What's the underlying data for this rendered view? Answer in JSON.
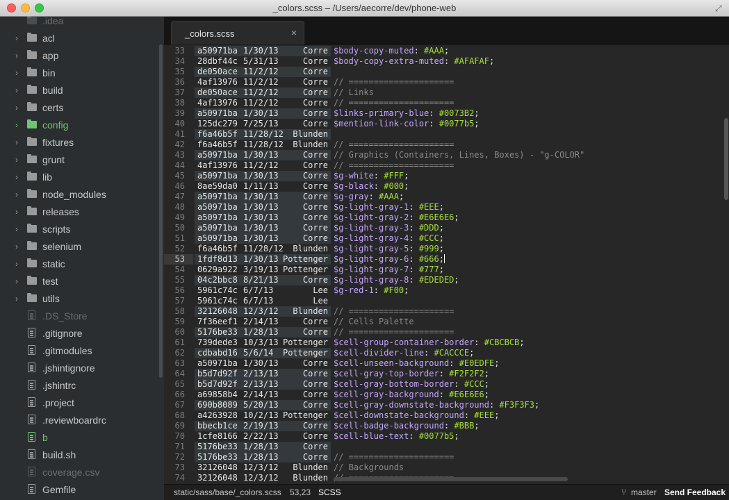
{
  "window": {
    "title": "_colors.scss – /Users/aecorre/dev/phone-web"
  },
  "sidebar": {
    "items": [
      {
        "label": ".idea",
        "kind": "folder",
        "state": "dim"
      },
      {
        "label": "acl",
        "kind": "folder",
        "state": "normal"
      },
      {
        "label": "app",
        "kind": "folder",
        "state": "normal"
      },
      {
        "label": "bin",
        "kind": "folder",
        "state": "normal"
      },
      {
        "label": "build",
        "kind": "folder",
        "state": "normal"
      },
      {
        "label": "certs",
        "kind": "folder",
        "state": "normal"
      },
      {
        "label": "config",
        "kind": "folder",
        "state": "active"
      },
      {
        "label": "fixtures",
        "kind": "folder",
        "state": "normal"
      },
      {
        "label": "grunt",
        "kind": "folder",
        "state": "normal"
      },
      {
        "label": "lib",
        "kind": "folder",
        "state": "normal"
      },
      {
        "label": "node_modules",
        "kind": "folder",
        "state": "normal"
      },
      {
        "label": "releases",
        "kind": "folder",
        "state": "normal"
      },
      {
        "label": "scripts",
        "kind": "folder",
        "state": "normal"
      },
      {
        "label": "selenium",
        "kind": "folder",
        "state": "normal"
      },
      {
        "label": "static",
        "kind": "folder",
        "state": "normal"
      },
      {
        "label": "test",
        "kind": "folder",
        "state": "normal"
      },
      {
        "label": "utils",
        "kind": "folder",
        "state": "normal"
      },
      {
        "label": ".DS_Store",
        "kind": "file",
        "state": "dim"
      },
      {
        "label": ".gitignore",
        "kind": "file",
        "state": "normal"
      },
      {
        "label": ".gitmodules",
        "kind": "file",
        "state": "normal"
      },
      {
        "label": ".jshintignore",
        "kind": "file",
        "state": "normal"
      },
      {
        "label": ".jshintrc",
        "kind": "file",
        "state": "normal"
      },
      {
        "label": ".project",
        "kind": "file",
        "state": "normal"
      },
      {
        "label": ".reviewboardrc",
        "kind": "file",
        "state": "normal"
      },
      {
        "label": "b",
        "kind": "file",
        "state": "active"
      },
      {
        "label": "build.sh",
        "kind": "file",
        "state": "normal"
      },
      {
        "label": "coverage.csv",
        "kind": "file",
        "state": "dim"
      },
      {
        "label": "Gemfile",
        "kind": "file",
        "state": "normal"
      }
    ]
  },
  "tabs": [
    {
      "label": "_colors.scss",
      "close": "×"
    }
  ],
  "editor": {
    "current_line": 53,
    "lines": [
      {
        "n": 33,
        "hash": "a50971ba",
        "date": "1/30/13",
        "author": "Corre",
        "alt": true,
        "code": [
          [
            "var",
            "$body-copy-muted"
          ],
          [
            "p",
            ": "
          ],
          [
            "val",
            "#AAA"
          ],
          [
            "p",
            ";"
          ]
        ]
      },
      {
        "n": 34,
        "hash": "28dbf44c",
        "date": "5/31/13",
        "author": "Corre",
        "alt": false,
        "code": [
          [
            "var",
            "$body-copy-extra-muted"
          ],
          [
            "p",
            ": "
          ],
          [
            "val",
            "#AFAFAF"
          ],
          [
            "p",
            ";"
          ]
        ]
      },
      {
        "n": 35,
        "hash": "de050ace",
        "date": "11/2/12",
        "author": "Corre",
        "alt": true,
        "code": []
      },
      {
        "n": 36,
        "hash": "4af13976",
        "date": "11/2/12",
        "author": "Corre",
        "alt": false,
        "code": [
          [
            "c",
            "// ====================="
          ]
        ]
      },
      {
        "n": 37,
        "hash": "de050ace",
        "date": "11/2/12",
        "author": "Corre",
        "alt": true,
        "code": [
          [
            "c",
            "// Links"
          ]
        ]
      },
      {
        "n": 38,
        "hash": "4af13976",
        "date": "11/2/12",
        "author": "Corre",
        "alt": false,
        "code": [
          [
            "c",
            "// ====================="
          ]
        ]
      },
      {
        "n": 39,
        "hash": "a50971ba",
        "date": "1/30/13",
        "author": "Corre",
        "alt": true,
        "code": [
          [
            "var",
            "$links-primary-blue"
          ],
          [
            "p",
            ": "
          ],
          [
            "val",
            "#0073B2"
          ],
          [
            "p",
            ";"
          ]
        ]
      },
      {
        "n": 40,
        "hash": "125dc279",
        "date": "7/25/13",
        "author": "Corre",
        "alt": false,
        "code": [
          [
            "var",
            "$mention-link-color"
          ],
          [
            "p",
            ": "
          ],
          [
            "val",
            "#0077b5"
          ],
          [
            "p",
            ";"
          ]
        ]
      },
      {
        "n": 41,
        "hash": "f6a46b5f",
        "date": "11/28/12",
        "author": "Blunden",
        "alt": true,
        "code": []
      },
      {
        "n": 42,
        "hash": "f6a46b5f",
        "date": "11/28/12",
        "author": "Blunden",
        "alt": false,
        "code": [
          [
            "c",
            "// ====================="
          ]
        ]
      },
      {
        "n": 43,
        "hash": "a50971ba",
        "date": "1/30/13",
        "author": "Corre",
        "alt": true,
        "code": [
          [
            "c",
            "// Graphics (Containers, Lines, Boxes) - \"g-COLOR\""
          ]
        ]
      },
      {
        "n": 44,
        "hash": "4af13976",
        "date": "11/2/12",
        "author": "Corre",
        "alt": false,
        "code": [
          [
            "c",
            "// ====================="
          ]
        ]
      },
      {
        "n": 45,
        "hash": "a50971ba",
        "date": "1/30/13",
        "author": "Corre",
        "alt": true,
        "code": [
          [
            "var",
            "$g-white"
          ],
          [
            "p",
            ": "
          ],
          [
            "val",
            "#FFF"
          ],
          [
            "p",
            ";"
          ]
        ]
      },
      {
        "n": 46,
        "hash": "8ae59da0",
        "date": "1/11/13",
        "author": "Corre",
        "alt": false,
        "code": [
          [
            "var",
            "$g-black"
          ],
          [
            "p",
            ": "
          ],
          [
            "val",
            "#000"
          ],
          [
            "p",
            ";"
          ]
        ]
      },
      {
        "n": 47,
        "hash": "a50971ba",
        "date": "1/30/13",
        "author": "Corre",
        "alt": true,
        "code": [
          [
            "var",
            "$g-gray"
          ],
          [
            "p",
            ": "
          ],
          [
            "val",
            "#AAA"
          ],
          [
            "p",
            ";"
          ]
        ]
      },
      {
        "n": 48,
        "hash": "a50971ba",
        "date": "1/30/13",
        "author": "Corre",
        "alt": true,
        "code": [
          [
            "var",
            "$g-light-gray-1"
          ],
          [
            "p",
            ": "
          ],
          [
            "val",
            "#EEE"
          ],
          [
            "p",
            ";"
          ]
        ]
      },
      {
        "n": 49,
        "hash": "a50971ba",
        "date": "1/30/13",
        "author": "Corre",
        "alt": true,
        "code": [
          [
            "var",
            "$g-light-gray-2"
          ],
          [
            "p",
            ": "
          ],
          [
            "val",
            "#E6E6E6"
          ],
          [
            "p",
            ";"
          ]
        ]
      },
      {
        "n": 50,
        "hash": "a50971ba",
        "date": "1/30/13",
        "author": "Corre",
        "alt": true,
        "code": [
          [
            "var",
            "$g-light-gray-3"
          ],
          [
            "p",
            ": "
          ],
          [
            "val",
            "#DDD"
          ],
          [
            "p",
            ";"
          ]
        ]
      },
      {
        "n": 51,
        "hash": "a50971ba",
        "date": "1/30/13",
        "author": "Corre",
        "alt": true,
        "code": [
          [
            "var",
            "$g-light-gray-4"
          ],
          [
            "p",
            ": "
          ],
          [
            "val",
            "#CCC"
          ],
          [
            "p",
            ";"
          ]
        ]
      },
      {
        "n": 52,
        "hash": "f6a46b5f",
        "date": "11/28/12",
        "author": "Blunden",
        "alt": false,
        "code": [
          [
            "var",
            "$g-light-gray-5"
          ],
          [
            "p",
            ": "
          ],
          [
            "val",
            "#999"
          ],
          [
            "p",
            ";"
          ]
        ]
      },
      {
        "n": 53,
        "hash": "1fdf8d13",
        "date": "1/30/13",
        "author": "Pottenger",
        "alt": true,
        "code": [
          [
            "var",
            "$g-light-gray-6"
          ],
          [
            "p",
            ": "
          ],
          [
            "val",
            "#666"
          ],
          [
            "p",
            ";"
          ]
        ]
      },
      {
        "n": 54,
        "hash": "0629a922",
        "date": "3/19/13",
        "author": "Pottenger",
        "alt": false,
        "code": [
          [
            "var",
            "$g-light-gray-7"
          ],
          [
            "p",
            ": "
          ],
          [
            "val",
            "#777"
          ],
          [
            "p",
            ";"
          ]
        ]
      },
      {
        "n": 55,
        "hash": "04c2bbc8",
        "date": "8/21/13",
        "author": "Corre",
        "alt": true,
        "code": [
          [
            "var",
            "$g-light-gray-8"
          ],
          [
            "p",
            ": "
          ],
          [
            "val",
            "#EDEDED"
          ],
          [
            "p",
            ";"
          ]
        ]
      },
      {
        "n": 56,
        "hash": "5961c74c",
        "date": "6/7/13",
        "author": "Lee",
        "alt": false,
        "code": [
          [
            "var",
            "$g-red-1"
          ],
          [
            "p",
            ": "
          ],
          [
            "val",
            "#F00"
          ],
          [
            "p",
            ";"
          ]
        ]
      },
      {
        "n": 57,
        "hash": "5961c74c",
        "date": "6/7/13",
        "author": "Lee",
        "alt": false,
        "code": []
      },
      {
        "n": 58,
        "hash": "32126048",
        "date": "12/3/12",
        "author": "Blunden",
        "alt": true,
        "code": [
          [
            "c",
            "// ====================="
          ]
        ]
      },
      {
        "n": 59,
        "hash": "7f36eef1",
        "date": "2/14/13",
        "author": "Corre",
        "alt": false,
        "code": [
          [
            "c",
            "// Cells Palette"
          ]
        ]
      },
      {
        "n": 60,
        "hash": "5176be33",
        "date": "1/28/13",
        "author": "Corre",
        "alt": true,
        "code": [
          [
            "c",
            "// ====================="
          ]
        ]
      },
      {
        "n": 61,
        "hash": "739dede3",
        "date": "10/3/13",
        "author": "Pottenger",
        "alt": false,
        "code": [
          [
            "var",
            "$cell-group-container-border"
          ],
          [
            "p",
            ": "
          ],
          [
            "val",
            "#CBCBCB"
          ],
          [
            "p",
            ";"
          ]
        ]
      },
      {
        "n": 62,
        "hash": "cdbabd16",
        "date": "5/6/14",
        "author": "Pottenger",
        "alt": true,
        "code": [
          [
            "var",
            "$cell-divider-line"
          ],
          [
            "p",
            ": "
          ],
          [
            "val",
            "#CACCCE"
          ],
          [
            "p",
            ";"
          ]
        ]
      },
      {
        "n": 63,
        "hash": "a50971ba",
        "date": "1/30/13",
        "author": "Corre",
        "alt": false,
        "code": [
          [
            "var",
            "$cell-unseen-background"
          ],
          [
            "p",
            ": "
          ],
          [
            "val",
            "#E0EDFE"
          ],
          [
            "p",
            ";"
          ]
        ]
      },
      {
        "n": 64,
        "hash": "b5d7d92f",
        "date": "2/13/13",
        "author": "Corre",
        "alt": true,
        "code": [
          [
            "var",
            "$cell-gray-top-border"
          ],
          [
            "p",
            ": "
          ],
          [
            "val",
            "#F2F2F2"
          ],
          [
            "p",
            ";"
          ]
        ]
      },
      {
        "n": 65,
        "hash": "b5d7d92f",
        "date": "2/13/13",
        "author": "Corre",
        "alt": true,
        "code": [
          [
            "var",
            "$cell-gray-bottom-border"
          ],
          [
            "p",
            ": "
          ],
          [
            "val",
            "#CCC"
          ],
          [
            "p",
            ";"
          ]
        ]
      },
      {
        "n": 66,
        "hash": "a69858b4",
        "date": "2/14/13",
        "author": "Corre",
        "alt": false,
        "code": [
          [
            "var",
            "$cell-gray-background"
          ],
          [
            "p",
            ": "
          ],
          [
            "val",
            "#E6E6E6"
          ],
          [
            "p",
            ";"
          ]
        ]
      },
      {
        "n": 67,
        "hash": "690b8089",
        "date": "5/20/13",
        "author": "Corre",
        "alt": true,
        "code": [
          [
            "var",
            "$cell-gray-downstate-background"
          ],
          [
            "p",
            ": "
          ],
          [
            "val",
            "#F3F3F3"
          ],
          [
            "p",
            ";"
          ]
        ]
      },
      {
        "n": 68,
        "hash": "a4263928",
        "date": "10/2/13",
        "author": "Pottenger",
        "alt": false,
        "code": [
          [
            "var",
            "$cell-downstate-background"
          ],
          [
            "p",
            ": "
          ],
          [
            "val",
            "#EEE"
          ],
          [
            "p",
            ";"
          ]
        ]
      },
      {
        "n": 69,
        "hash": "bbecb1ce",
        "date": "2/19/13",
        "author": "Corre",
        "alt": true,
        "code": [
          [
            "var",
            "$cell-badge-background"
          ],
          [
            "p",
            ": "
          ],
          [
            "val",
            "#BBB"
          ],
          [
            "p",
            ";"
          ]
        ]
      },
      {
        "n": 70,
        "hash": "1cfe8166",
        "date": "2/22/13",
        "author": "Corre",
        "alt": false,
        "code": [
          [
            "var",
            "$cell-blue-text"
          ],
          [
            "p",
            ": "
          ],
          [
            "val",
            "#0077b5"
          ],
          [
            "p",
            ";"
          ]
        ]
      },
      {
        "n": 71,
        "hash": "5176be33",
        "date": "1/28/13",
        "author": "Corre",
        "alt": true,
        "code": []
      },
      {
        "n": 72,
        "hash": "5176be33",
        "date": "1/28/13",
        "author": "Corre",
        "alt": true,
        "code": [
          [
            "c",
            "// ====================="
          ]
        ]
      },
      {
        "n": 73,
        "hash": "32126048",
        "date": "12/3/12",
        "author": "Blunden",
        "alt": false,
        "code": [
          [
            "c",
            "// Backgrounds"
          ]
        ]
      },
      {
        "n": 74,
        "hash": "32126048",
        "date": "12/3/12",
        "author": "Blunden",
        "alt": false,
        "code": [
          [
            "c",
            "// ====================="
          ]
        ]
      }
    ]
  },
  "statusbar": {
    "path": "static/sass/base/_colors.scss",
    "position": "53,23",
    "syntax": "SCSS",
    "branch_icon": "⑂",
    "branch": "master",
    "feedback": "Send Feedback"
  },
  "colors": {
    "variable": "#c5a5ff",
    "value": "#a6e22e",
    "comment": "#8a8a8a",
    "active_green": "#6fc46f"
  }
}
